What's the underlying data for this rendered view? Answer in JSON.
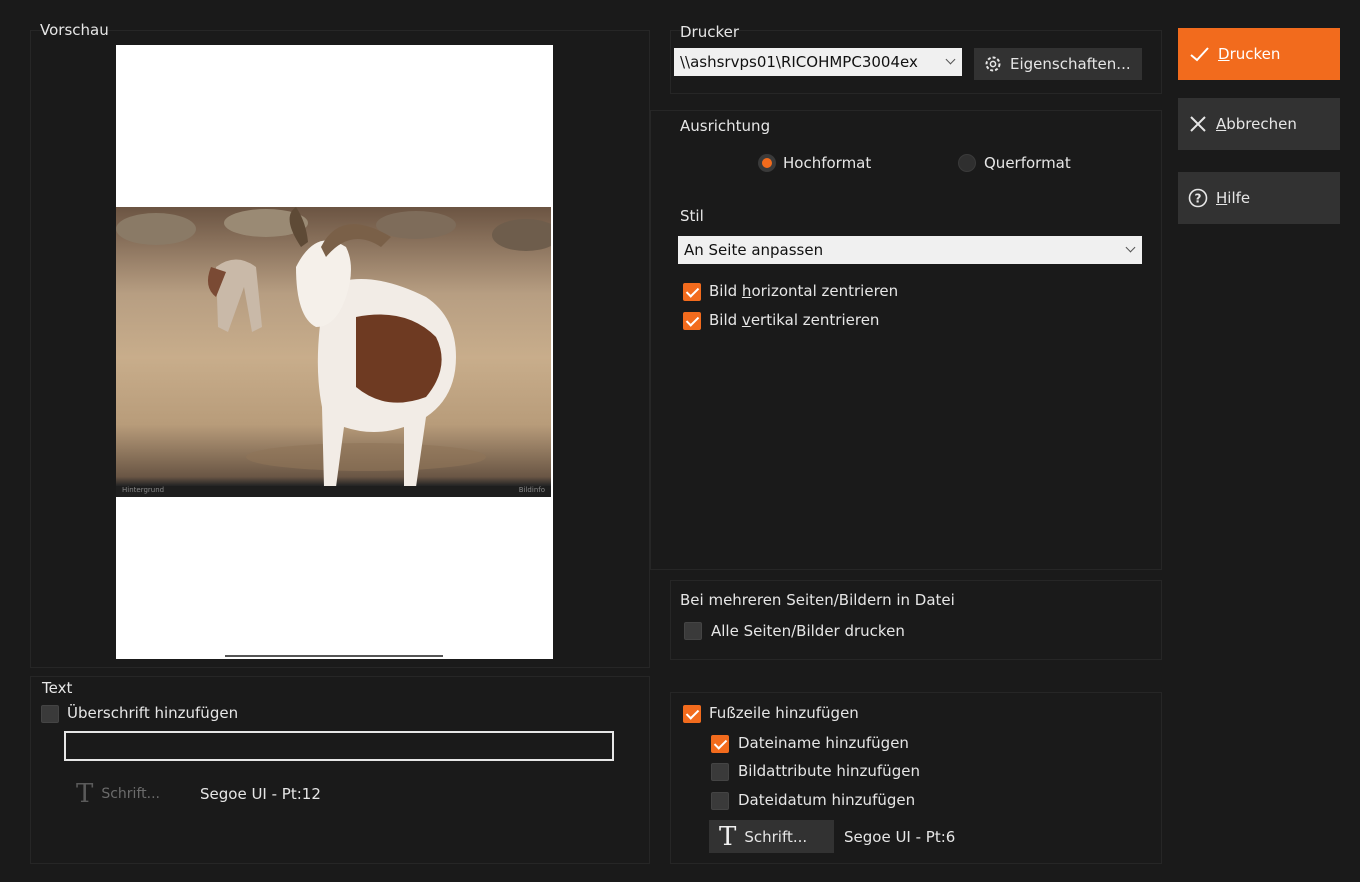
{
  "preview": {
    "label": "Vorschau",
    "photo_caption_left": "Hintergrund",
    "photo_caption_right": "Bildinfo"
  },
  "printer": {
    "label": "Drucker",
    "selected": "\\\\ashsrvps01\\RICOHMPC3004ex",
    "properties_label": "Eigenschaften..."
  },
  "orientation": {
    "label": "Ausrichtung",
    "portrait": "Hochformat",
    "landscape": "Querformat",
    "selected": "portrait"
  },
  "style": {
    "label": "Stil",
    "selected": "An Seite anpassen",
    "center_h_pre": "Bild ",
    "center_h_key": "h",
    "center_h_post": "orizontal zentrieren",
    "center_v_pre": "Bild ",
    "center_v_key": "v",
    "center_v_post": "ertikal zentrieren"
  },
  "multi": {
    "label": "Bei mehreren Seiten/Bildern in Datei",
    "all_pages": "Alle Seiten/Bilder drucken"
  },
  "text_section": {
    "label": "Text",
    "heading_checkbox": "Überschrift hinzufügen",
    "heading_value": "",
    "font_button": "Schrift...",
    "font_info": "Segoe UI - Pt:12"
  },
  "footer_section": {
    "add_footer": "Fußzeile hinzufügen",
    "filename": "Dateiname hinzufügen",
    "attributes": "Bildattribute hinzufügen",
    "date": "Dateidatum hinzufügen",
    "font_button": "Schrift...",
    "font_info": "Segoe UI - Pt:6"
  },
  "actions": {
    "print_key": "D",
    "print_rest": "rucken",
    "cancel_key": "A",
    "cancel_rest": "bbrechen",
    "help_key": "H",
    "help_rest": "ilfe"
  },
  "colors": {
    "accent": "#f26b1d",
    "background": "#1a1a1a",
    "button": "#323232"
  }
}
